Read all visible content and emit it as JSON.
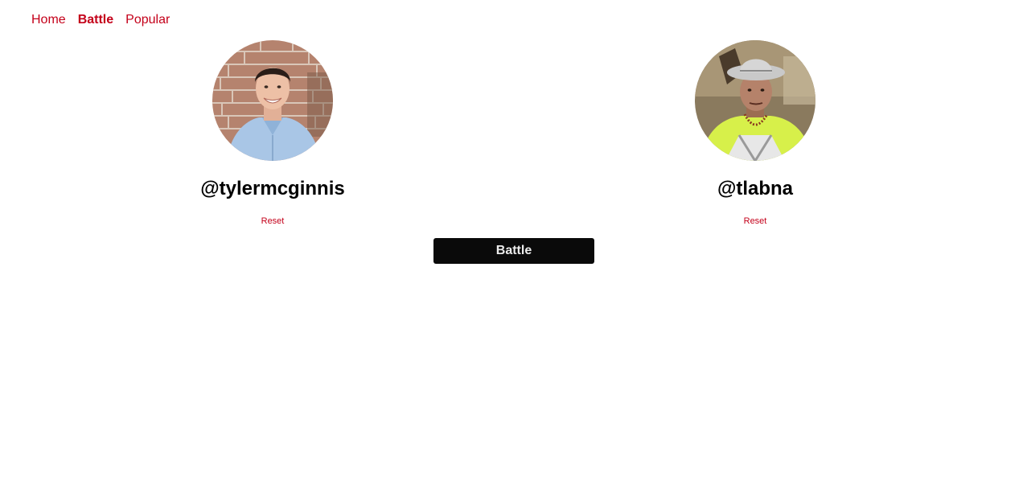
{
  "nav": {
    "items": [
      {
        "label": "Home",
        "active": false
      },
      {
        "label": "Battle",
        "active": true
      },
      {
        "label": "Popular",
        "active": false
      }
    ]
  },
  "players": [
    {
      "username": "@tylermcginnis",
      "reset_label": "Reset",
      "avatar": "user-avatar"
    },
    {
      "username": "@tlabna",
      "reset_label": "Reset",
      "avatar": "user-avatar"
    }
  ],
  "battle_button": {
    "label": "Battle"
  },
  "colors": {
    "accent": "#c4001a",
    "button_bg": "#0a0a0a",
    "button_text": "#ececec"
  }
}
